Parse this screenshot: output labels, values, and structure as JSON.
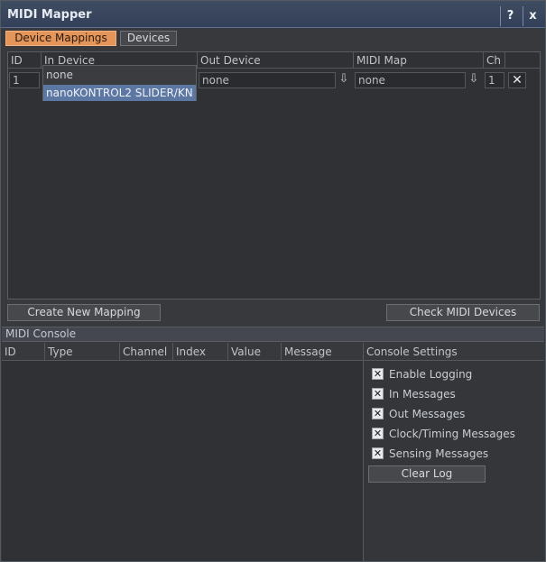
{
  "window": {
    "title": "MIDI Mapper",
    "help_label": "?",
    "close_label": "x"
  },
  "tabs": [
    {
      "label": "Device Mappings",
      "active": true
    },
    {
      "label": "Devices",
      "active": false
    }
  ],
  "mappings": {
    "columns": [
      "ID",
      "In Device",
      "Out Device",
      "MIDI Map",
      "Ch"
    ],
    "row": {
      "id": "1",
      "out_device": "none",
      "midi_map": "none",
      "channel": "1"
    },
    "in_device_dropdown": {
      "options": [
        "none",
        "nanoKONTROL2 SLIDER/KN"
      ],
      "highlighted": "nanoKONTROL2 SLIDER/KN"
    },
    "create_button": "Create New Mapping",
    "check_button": "Check MIDI Devices"
  },
  "console": {
    "title": "MIDI Console",
    "columns": [
      "ID",
      "Type",
      "Channel",
      "Index",
      "Value",
      "Message"
    ],
    "settings_title": "Console Settings",
    "settings": [
      {
        "label": "Enable Logging",
        "checked": true
      },
      {
        "label": "In Messages",
        "checked": true
      },
      {
        "label": "Out Messages",
        "checked": true
      },
      {
        "label": "Clock/Timing Messages",
        "checked": true
      },
      {
        "label": "Sensing Messages",
        "checked": true
      }
    ],
    "clear_button": "Clear Log"
  },
  "icons": {
    "dropdown": "down-arrow-icon",
    "delete": "close-icon",
    "check": "x-mark"
  },
  "colors": {
    "accent_tab": "#e3955a",
    "titlebar": "#3e4c61",
    "selection": "#5d77a3"
  }
}
